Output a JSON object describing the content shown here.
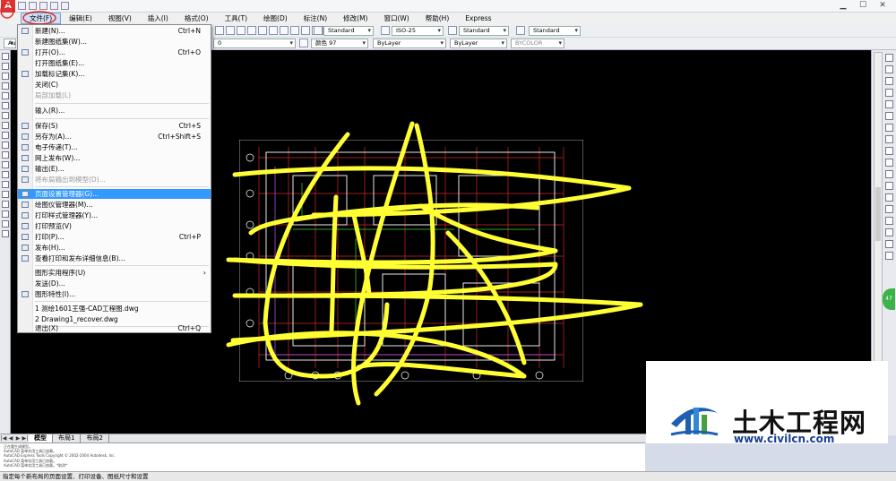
{
  "menubar": {
    "items": [
      "文件(F)",
      "编辑(E)",
      "视图(V)",
      "插入(I)",
      "格式(O)",
      "工具(T)",
      "绘图(D)",
      "标注(N)",
      "修改(M)",
      "窗口(W)",
      "帮助(H)",
      "Express"
    ]
  },
  "toolbar": {
    "text_style": "Standard",
    "dim_style": "ISO-25",
    "table_style": "Standard",
    "mleader_style": "Standard",
    "workspace": "AutoCAD",
    "layer": "0",
    "color": "颜色 97",
    "linetype": "ByLayer",
    "lineweight": "ByLayer",
    "plot_style": "BYCOLOR"
  },
  "file_menu": {
    "items": [
      {
        "label": "新建(N)...",
        "shortcut": "Ctrl+N"
      },
      {
        "label": "新建图纸集(W)...",
        "shortcut": ""
      },
      {
        "label": "打开(O)...",
        "shortcut": "Ctrl+O"
      },
      {
        "label": "打开图纸集(E)...",
        "shortcut": ""
      },
      {
        "label": "加载标记集(K)...",
        "shortcut": ""
      },
      {
        "label": "关闭(C)",
        "shortcut": ""
      },
      {
        "label": "局部加载(L)",
        "shortcut": ""
      },
      {
        "label": "输入(R)...",
        "shortcut": ""
      },
      {
        "label": "保存(S)",
        "shortcut": "Ctrl+S"
      },
      {
        "label": "另存为(A)...",
        "shortcut": "Ctrl+Shift+S"
      },
      {
        "label": "电子传递(T)...",
        "shortcut": ""
      },
      {
        "label": "网上发布(W)...",
        "shortcut": ""
      },
      {
        "label": "输出(E)...",
        "shortcut": ""
      },
      {
        "label": "将布局输出到模型(D)...",
        "shortcut": ""
      },
      {
        "label": "页面设置管理器(G)...",
        "shortcut": ""
      },
      {
        "label": "绘图仪管理器(M)...",
        "shortcut": ""
      },
      {
        "label": "打印样式管理器(Y)...",
        "shortcut": ""
      },
      {
        "label": "打印预览(V)",
        "shortcut": ""
      },
      {
        "label": "打印(P)...",
        "shortcut": "Ctrl+P"
      },
      {
        "label": "发布(H)...",
        "shortcut": ""
      },
      {
        "label": "查看打印和发布详细信息(B)...",
        "shortcut": ""
      },
      {
        "label": "图形实用程序(U)",
        "shortcut": ""
      },
      {
        "label": "发送(D)...",
        "shortcut": ""
      },
      {
        "label": "图形特性(I)...",
        "shortcut": ""
      },
      {
        "label": "1 测绘1601王强-CAD工程图.dwg",
        "shortcut": ""
      },
      {
        "label": "2 Drawing1_recover.dwg",
        "shortcut": ""
      },
      {
        "label": "退出(X)",
        "shortcut": "Ctrl+Q"
      }
    ]
  },
  "tabs": [
    "模型",
    "布局1",
    "布局2"
  ],
  "command_lines": [
    "正在重生成模型。",
    "AutoCAD 菜单实用工具已加载。",
    "AutoCAD Express Tools Copyright © 2002-2004 Autodesk, Inc.",
    "AutoCAD 菜单实用工具已加载。",
    "AutoCAD 菜单实用工具已加载。*取消*"
  ],
  "status_text": "指定每个新布局的页面设置、打印设备、图纸尺寸和设置",
  "watermark": {
    "title": "土木工程网",
    "url": "www.civilcn.com"
  },
  "side_badge": "47",
  "colors": {
    "menu_highlight": "#3399ff",
    "annotation_red": "#e02020",
    "scribble_yellow": "#ffff33",
    "canvas": "#000000",
    "watermark_blue": "#1a3f8f"
  }
}
